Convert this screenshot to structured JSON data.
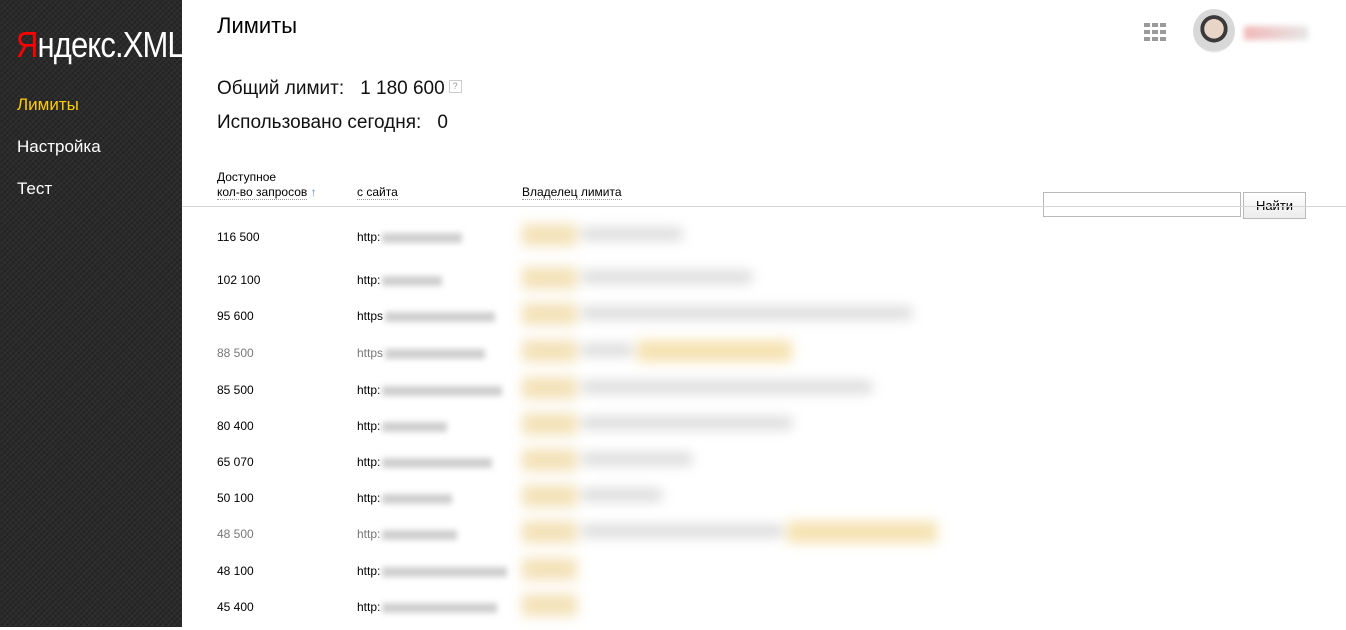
{
  "brand": {
    "first_letter": "Я",
    "rest": "ндекс.XML"
  },
  "nav": {
    "items": [
      {
        "label": "Лимиты",
        "active": true
      },
      {
        "label": "Настройка",
        "active": false
      },
      {
        "label": "Тест",
        "active": false
      }
    ]
  },
  "header": {
    "title": "Лимиты",
    "apps_icon": "grid-icon"
  },
  "summary": {
    "total_label": "Общий лимит:",
    "total_value": "1 180 600",
    "help": "?",
    "used_label": "Использовано сегодня:",
    "used_value": "0"
  },
  "search": {
    "button_label": "Найти",
    "value": "",
    "placeholder": ""
  },
  "table": {
    "headers": {
      "available_line1": "Доступное",
      "available_line2": "кол-во запросов",
      "sort_arrow": "↑",
      "site": "с сайта",
      "owner": "Владелец лимита"
    },
    "rows": [
      {
        "count": "116 500",
        "site": "http:",
        "muted": false
      },
      {
        "count": "102 100",
        "site": "http:",
        "muted": false
      },
      {
        "count": "95 600",
        "site": "https",
        "muted": false
      },
      {
        "count": "88 500",
        "site": "https",
        "muted": true
      },
      {
        "count": "85 500",
        "site": "http:",
        "muted": false
      },
      {
        "count": "80 400",
        "site": "http:",
        "muted": false
      },
      {
        "count": "65 070",
        "site": "http:",
        "muted": false
      },
      {
        "count": "50 100",
        "site": "http:",
        "muted": false
      },
      {
        "count": "48 500",
        "site": "http:",
        "muted": true
      },
      {
        "count": "48 100",
        "site": "http:",
        "muted": false
      },
      {
        "count": "45 400",
        "site": "http:",
        "muted": false
      }
    ]
  },
  "colors": {
    "accent": "#ffcc00",
    "logo_red": "#ff0000",
    "sidebar_bg": "#2b2b2b"
  }
}
